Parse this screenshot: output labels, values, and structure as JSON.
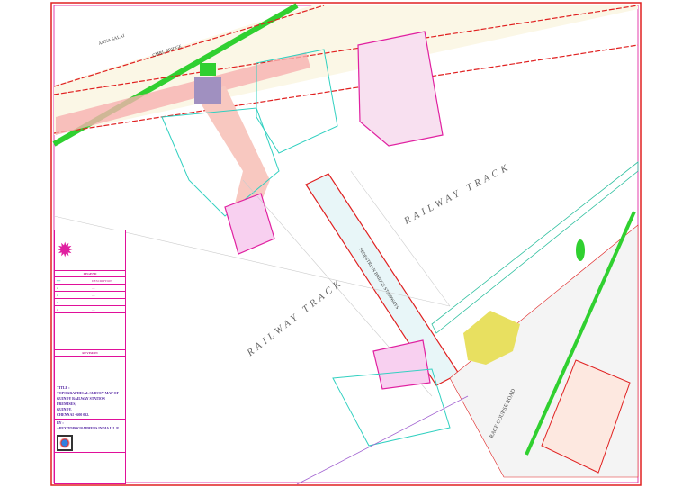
{
  "map": {
    "road_labels": {
      "anna_salai": "ANNA SALAI",
      "cmrl_bridge": "CMRL BRIDGE",
      "race_course_road": "RACE COURSE ROAD"
    },
    "railway_labels": [
      "RAILWAY TRACK",
      "RAILWAY TRACK"
    ],
    "bridge_label": "PEDESTRIAN BRIDGE STAIRWAYS"
  },
  "title_block": {
    "legend_heading": "LEGEND",
    "legend_description": "DESCRIPTION",
    "revision_heading": "REVISION",
    "title_label": "TITLE :",
    "title_lines": [
      "TOPOGRAPHICAL SURVEY MAP OF",
      "GUINDY RAILWAY STATION PREMISES,",
      "GUINDY,",
      "CHENNAI - 600 032."
    ],
    "company_label": "BY :",
    "company": "APEX TOPOGRAPHERS INDIA L.L.P"
  },
  "colors": {
    "border": "#e0109a",
    "frame": "#e02020",
    "green": "#30d030",
    "pink": "#f8b0b0",
    "bridge": "#e8f6f8",
    "magenta": "#e020a0",
    "yellow": "#e8e060"
  }
}
